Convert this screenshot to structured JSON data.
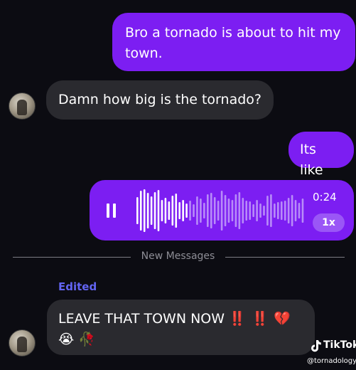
{
  "messages": {
    "msg1": "Bro a tornado is about to hit my town.",
    "msg2": "Damn how big is the tornado?",
    "msg3": "Its like",
    "voice": {
      "duration": "0:24",
      "speed": "1x",
      "played_fraction": 0.32
    },
    "divider": "New Messages",
    "edited_label": "Edited",
    "msg4_text": "LEAVE THAT TOWN NOW",
    "msg4_emojis": {
      "exclamations": "‼️ ‼️",
      "broken_heart": "💔",
      "crying": "😭",
      "wilted_rose": "🥀"
    }
  },
  "watermark": {
    "name": "TikTok",
    "handle": "@tornadology"
  },
  "colors": {
    "outgoing_bubble": "#7c1ef2",
    "incoming_bubble": "#2a2a2f",
    "background": "#0c0c12",
    "edited_label": "#6264f2"
  }
}
